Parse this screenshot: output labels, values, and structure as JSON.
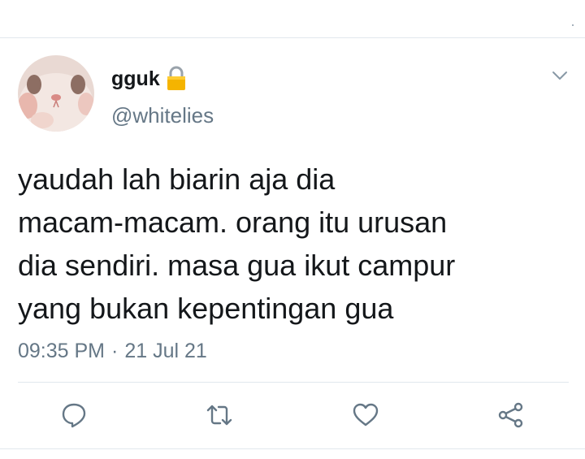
{
  "tweet": {
    "display_name": "gguk",
    "handle": "@whitelies",
    "protected_icon": "lock-icon",
    "text": "yaudah lah biarin aja dia\nmacam-macam. orang itu urusan\ndia sendiri. masa gua ikut campur\nyang bukan kepentingan gua",
    "time": "09:35 PM",
    "separator": "·",
    "date": "21 Jul 21"
  },
  "actions": [
    {
      "name": "reply",
      "icon": "comment-icon"
    },
    {
      "name": "retweet",
      "icon": "retweet-icon"
    },
    {
      "name": "like",
      "icon": "heart-icon"
    },
    {
      "name": "share",
      "icon": "share-icon"
    }
  ],
  "menu": {
    "icon": "chevron-down-icon"
  },
  "colors": {
    "text_primary": "#14171a",
    "text_secondary": "#657786",
    "icon": "#657786",
    "divider": "#e1e8ed",
    "lock": "#f5b400"
  }
}
